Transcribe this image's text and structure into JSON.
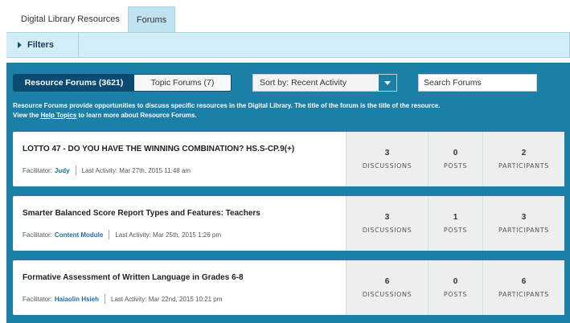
{
  "top_tabs": [
    {
      "label": "Digital Library Resources"
    },
    {
      "label": "Forums"
    }
  ],
  "filters": {
    "label": "Filters"
  },
  "toggle": {
    "resource_label": "Resource Forums (3621)",
    "topic_label": "Topic Forums (7)"
  },
  "sort": {
    "selected": "Sort by: Recent Activity"
  },
  "search": {
    "placeholder": "Search Forums"
  },
  "description": {
    "bold_lead": "Resource Forums",
    "text_before_link": " provide opportunities to discuss specific resources in the Digital Library. The title of the forum is the title of the resource. View the ",
    "link": "Help Topics",
    "text_after_link": " to learn more about Resource Forums."
  },
  "labels": {
    "facilitator": "Facilitator:",
    "last_activity": "Last Activity:",
    "discussions": "DISCUSSIONS",
    "posts": "POSTS",
    "participants": "PARTICIPANTS"
  },
  "forums": [
    {
      "title": "LOTTO 47 - DO YOU HAVE THE WINNING COMBINATION? HS.S-CP.9(+)",
      "facilitator": "Judy",
      "last_activity": "Mar 27th, 2015 11:48 am",
      "discussions": "3",
      "posts": "0",
      "participants": "2"
    },
    {
      "title": "Smarter Balanced Score Report Types and Features: Teachers",
      "facilitator": "Content Module",
      "last_activity": "Mar 25th, 2015 1:26 pm",
      "discussions": "3",
      "posts": "1",
      "participants": "3"
    },
    {
      "title": "Formative Assessment of Written Language in Grades 6-8",
      "facilitator": "Haiaolin Hsieh",
      "last_activity": "Mar 22nd, 2015 10:21 pm",
      "discussions": "6",
      "posts": "0",
      "participants": "6"
    }
  ]
}
